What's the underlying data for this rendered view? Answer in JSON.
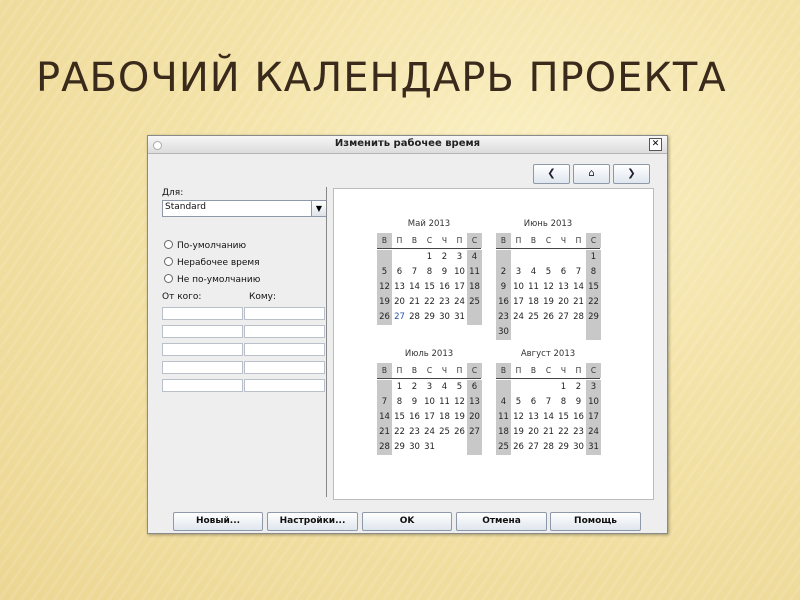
{
  "slide": {
    "title": "РАБОЧИЙ КАЛЕНДАРЬ ПРОЕКТА"
  },
  "dialog": {
    "title": "Изменить рабочее время",
    "close_glyph": "✕",
    "nav": {
      "prev": "❮",
      "home": "⌂",
      "next": "❯"
    },
    "for_label": "Для:",
    "calendar_select": "Standard",
    "options": [
      "По-умолчанию",
      "Нерабочее время",
      "Не по-умолчанию"
    ],
    "from_label": "От кого:",
    "to_label": "Кому:",
    "buttons": {
      "new": "Новый...",
      "settings": "Настройки...",
      "ok": "OK",
      "cancel": "Отмена",
      "help": "Помощь"
    }
  },
  "calendar": {
    "weekdays": [
      "В",
      "П",
      "В",
      "С",
      "Ч",
      "П",
      "С"
    ],
    "weekend_color": "#c8c8c8",
    "months": [
      {
        "title": "Май 2013",
        "start": 3,
        "days": 31,
        "highlight": [
          27
        ]
      },
      {
        "title": "Июнь 2013",
        "start": 6,
        "days": 30,
        "highlight": []
      },
      {
        "title": "Июль 2013",
        "start": 1,
        "days": 31,
        "highlight": []
      },
      {
        "title": "Август 2013",
        "start": 4,
        "days": 31,
        "highlight": []
      }
    ]
  }
}
